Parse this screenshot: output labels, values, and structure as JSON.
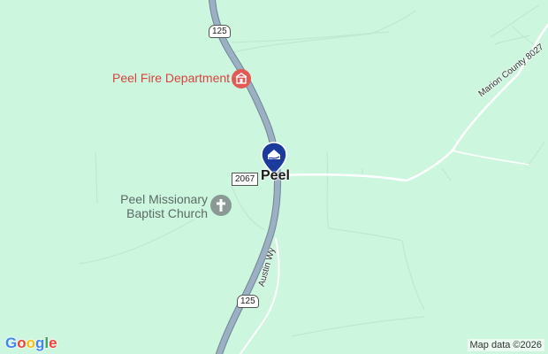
{
  "map": {
    "colors": {
      "land": "#cdf6df",
      "highway": "#8a9eb0",
      "minor_road": "#ffffff",
      "fire_poi": "#d6453f",
      "church_poi": "#5b6b66",
      "marker": "#1a3a9c"
    },
    "place": {
      "name": "Peel",
      "icon": "location-pin-icon"
    },
    "pois": {
      "fire": {
        "label": "Peel Fire Department",
        "icon": "fire-station-icon"
      },
      "church": {
        "label_line1": "Peel Missionary",
        "label_line2": "Baptist Church",
        "icon": "church-cross-icon"
      }
    },
    "shields": {
      "top": "125",
      "bottom": "125",
      "county": "2067"
    },
    "roads": {
      "austin": "Austin Wy",
      "marion": "Marion County 8027"
    },
    "branding": {
      "logo_letters": [
        "G",
        "o",
        "o",
        "g",
        "l",
        "e"
      ],
      "attribution": "Map data ©2026"
    }
  }
}
